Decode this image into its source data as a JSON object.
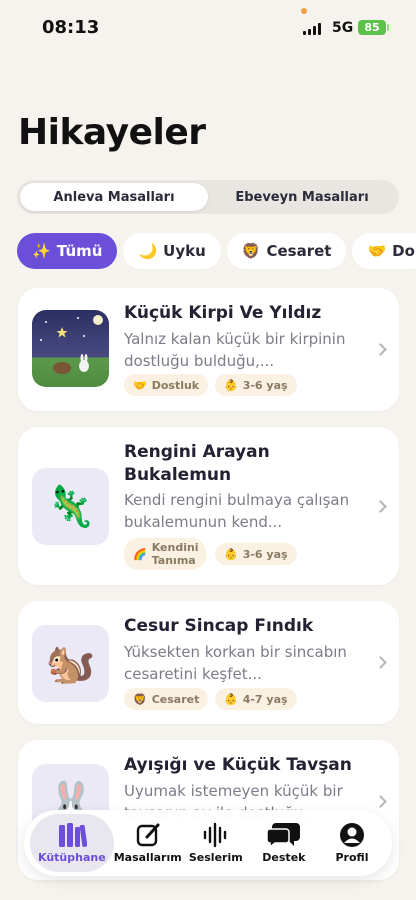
{
  "status_bar": {
    "time": "08:13",
    "network": "5G",
    "battery": "85"
  },
  "page": {
    "title": "Hikayeler"
  },
  "segments": [
    {
      "label": "Anleva Masalları",
      "active": true
    },
    {
      "label": "Ebeveyn Masalları",
      "active": false
    }
  ],
  "filters": [
    {
      "emoji": "✨",
      "label": "Tümü",
      "active": true
    },
    {
      "emoji": "🌙",
      "label": "Uyku",
      "active": false
    },
    {
      "emoji": "🦁",
      "label": "Cesaret",
      "active": false
    },
    {
      "emoji": "🤝",
      "label": "Do",
      "active": false
    }
  ],
  "stories": [
    {
      "title": "Küçük Kirpi Ve Yıldız",
      "description": "Yalnız kalan küçük bir kirpinin dostluğu bulduğu,...",
      "icon": "hedgehog-night-thumbnail",
      "tags": [
        {
          "emoji": "🤝",
          "label": "Dostluk"
        },
        {
          "emoji": "👶",
          "label": "3-6 yaş"
        }
      ]
    },
    {
      "title": "Rengini Arayan Bukalemun",
      "description": "Kendi rengini bulmaya çalışan bukalemunun kend...",
      "icon": "🦎",
      "tags": [
        {
          "emoji": "🌈",
          "label": "Kendini Tanıma"
        },
        {
          "emoji": "👶",
          "label": "3-6 yaş"
        }
      ]
    },
    {
      "title": "Cesur Sincap Fındık",
      "description": "Yüksekten korkan bir sincabın cesaretini keşfet...",
      "icon": "🐿️",
      "tags": [
        {
          "emoji": "🦁",
          "label": "Cesaret"
        },
        {
          "emoji": "👶",
          "label": "4-7 yaş"
        }
      ]
    },
    {
      "title": "Ayışığı ve Küçük Tavşan",
      "description": "Uyumak istemeyen küçük bir tavşanın ay ile dostluğu...",
      "icon": "🐰",
      "tags": []
    }
  ],
  "tabbar": [
    {
      "icon": "library-icon",
      "label": "Kütüphane",
      "active": true
    },
    {
      "icon": "edit-icon",
      "label": "Masallarım",
      "active": false
    },
    {
      "icon": "waveform-icon",
      "label": "Seslerim",
      "active": false
    },
    {
      "icon": "chat-icon",
      "label": "Destek",
      "active": false
    },
    {
      "icon": "profile-icon",
      "label": "Profil",
      "active": false
    }
  ],
  "colors": {
    "accent": "#6c4fd8",
    "background": "#f6f3ee",
    "battery": "#5cc24a"
  }
}
